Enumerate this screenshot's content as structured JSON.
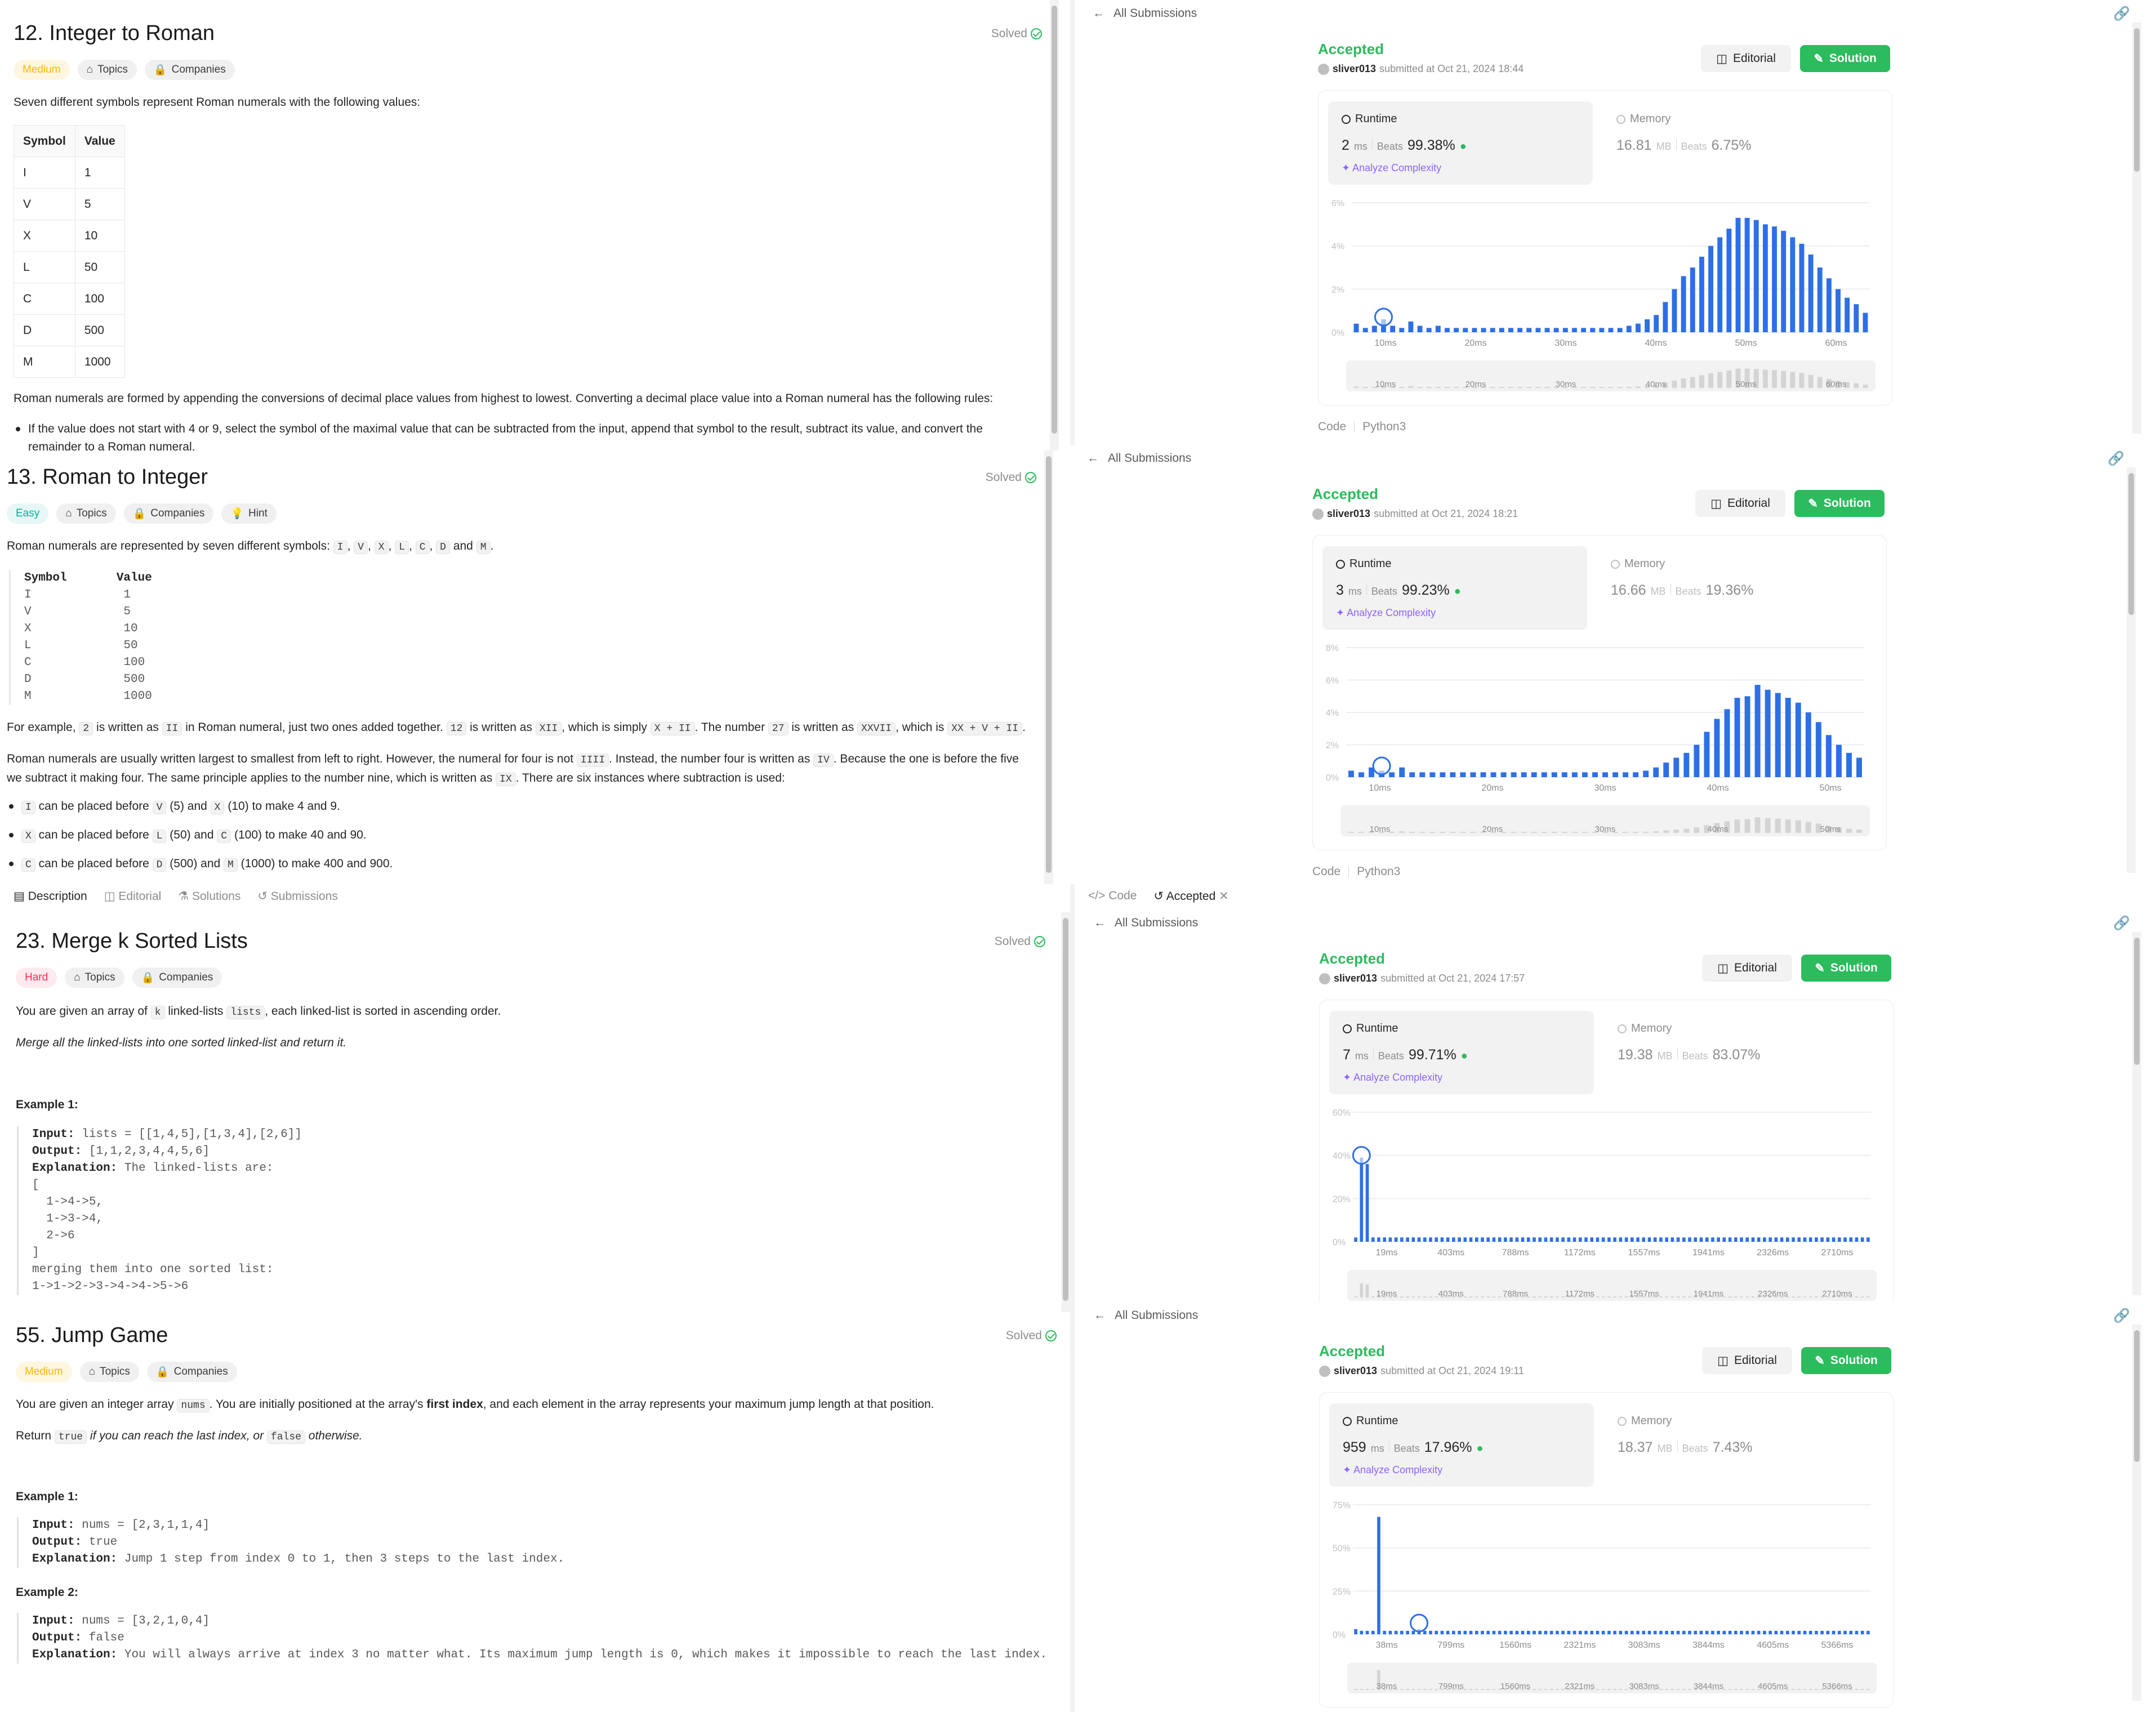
{
  "p12": {
    "title": "12. Integer to Roman",
    "solved": "Solved",
    "difficulty": "Medium",
    "topics": "Topics",
    "companies": "Companies",
    "intro": "Seven different symbols represent Roman numerals with the following values:",
    "table_headers": [
      "Symbol",
      "Value"
    ],
    "table_rows": [
      [
        "I",
        "1"
      ],
      [
        "V",
        "5"
      ],
      [
        "X",
        "10"
      ],
      [
        "L",
        "50"
      ],
      [
        "C",
        "100"
      ],
      [
        "D",
        "500"
      ],
      [
        "M",
        "1000"
      ]
    ],
    "para": "Roman numerals are formed by appending the conversions of decimal place values from highest to lowest. Converting a decimal place value into a Roman numeral has the following rules:",
    "bullet": "If the value does not start with 4 or 9, select the symbol of the maximal value that can be subtracted from the input, append that symbol to the result, subtract its value, and convert the",
    "bullet_cut": "remainder to a Roman numeral."
  },
  "p13": {
    "title": "13. Roman to Integer",
    "solved": "Solved",
    "difficulty": "Easy",
    "topics": "Topics",
    "companies": "Companies",
    "hint": "Hint",
    "intro_a": "Roman numerals are represented by seven different symbols: ",
    "intro_syms": [
      "I",
      "V",
      "X",
      "L",
      "C",
      "D",
      "M"
    ],
    "intro_and": " and ",
    "pre_header": "Symbol       Value",
    "pre_rows": [
      "I             1",
      "V             5",
      "X             10",
      "L             50",
      "C             100",
      "D             500",
      "M             1000"
    ],
    "ex_1": "For example, ",
    "ex_2": "2",
    "ex_3": " is written as ",
    "ex_4": "II",
    "ex_5": " in Roman numeral, just two ones added together. ",
    "ex_6": "12",
    "ex_7": " is written as ",
    "ex_8": "XII",
    "ex_9": ", which is simply ",
    "ex_10": "X + II",
    "ex_11": ". The number ",
    "ex_12": "27",
    "ex_13": " is written as ",
    "ex_14": "XXVII",
    "ex_15": ", which is ",
    "ex_16": "XX + V + II",
    "ex_17": ".",
    "usual_1": "Roman numerals are usually written largest to smallest from left to right. However, the numeral for four is not ",
    "usual_2": "IIII",
    "usual_3": ". Instead, the number four is written as ",
    "usual_4": "IV",
    "usual_5": ". Because the one is before the five we subtract it making four. The same principle applies to the number nine, which is written as ",
    "usual_6": "IX",
    "usual_7": ". There are six instances where subtraction is used:",
    "b1": [
      " can be placed before ",
      " (5) and ",
      " (10) to make 4 and 9."
    ],
    "b1c": [
      "I",
      "V",
      "X"
    ],
    "b2": [
      " can be placed before ",
      " (50) and ",
      " (100) to make 40 and 90."
    ],
    "b2c": [
      "X",
      "L",
      "C"
    ],
    "b3": [
      " can be placed before ",
      " (500) and ",
      " (1000) to make 400 and 900."
    ],
    "b3c": [
      "C",
      "D",
      "M"
    ]
  },
  "tabs_left": [
    "Description",
    "Editorial",
    "Solutions",
    "Submissions"
  ],
  "tabs_right": [
    "Code",
    "Accepted"
  ],
  "p23": {
    "title": "23. Merge k Sorted Lists",
    "solved": "Solved",
    "difficulty": "Hard",
    "topics": "Topics",
    "companies": "Companies",
    "l1a": "You are given an array of ",
    "l1b": "k",
    "l1c": " linked-lists ",
    "l1d": "lists",
    "l1e": ", each linked-list is sorted in ascending order.",
    "l2": "Merge all the linked-lists into one sorted linked-list and return it.",
    "ex1": "Example 1:",
    "in_lbl": "Input:",
    "in_val": " lists = [[1,4,5],[1,3,4],[2,6]]",
    "out_lbl": "Output:",
    "out_val": " [1,1,2,3,4,4,5,6]",
    "exp_lbl": "Explanation:",
    "exp_val": " The linked-lists are:",
    "rest": [
      "[",
      "  1->4->5,",
      "  1->3->4,",
      "  2->6",
      "]",
      "merging them into one sorted list:",
      "1->1->2->3->4->4->5->6"
    ]
  },
  "p55": {
    "title": "55. Jump Game",
    "solved": "Solved",
    "difficulty": "Medium",
    "topics": "Topics",
    "companies": "Companies",
    "l1a": "You are given an integer array ",
    "l1b": "nums",
    "l1c": ". You are initially positioned at the array's ",
    "l1d": "first index",
    "l1e": ", and each element in the array represents your maximum jump length at that position.",
    "l2a": "Return ",
    "l2b": "true",
    "l2c": " if you can reach the last index, or ",
    "l2d": "false",
    "l2e": " otherwise.",
    "ex1": "Example 1:",
    "ex1_in": " nums = [2,3,1,1,4]",
    "ex1_out": " true",
    "ex1_exp": " Jump 1 step from index 0 to 1, then 3 steps to the last index.",
    "ex2": "Example 2:",
    "ex2_in": " nums = [3,2,1,0,4]",
    "ex2_out": " false",
    "ex2_exp": " You will always arrive at index 3 no matter what. Its maximum jump length is 0, which makes it impossible to reach the last index.",
    "in_lbl": "Input:",
    "out_lbl": "Output:",
    "exp_lbl": "Explanation:"
  },
  "submissions": [
    {
      "all": "All Submissions",
      "status": "Accepted",
      "user": "sliver013",
      "submitted": "submitted at Oct 21, 2024 18:44",
      "editorial": "Editorial",
      "solution": "Solution",
      "runtime_label": "Runtime",
      "runtime": "2",
      "runtime_unit": "ms",
      "beats_label": "Beats",
      "runtime_beats": "99.38%",
      "analyze": "Analyze Complexity",
      "memory_label": "Memory",
      "memory": "16.81",
      "memory_unit": "MB",
      "memory_beats": "6.75%",
      "code_label": "Code",
      "lang": "Python3"
    },
    {
      "all": "All Submissions",
      "status": "Accepted",
      "user": "sliver013",
      "submitted": "submitted at Oct 21, 2024 18:21",
      "editorial": "Editorial",
      "solution": "Solution",
      "runtime_label": "Runtime",
      "runtime": "3",
      "runtime_unit": "ms",
      "beats_label": "Beats",
      "runtime_beats": "99.23%",
      "analyze": "Analyze Complexity",
      "memory_label": "Memory",
      "memory": "16.66",
      "memory_unit": "MB",
      "memory_beats": "19.36%",
      "code_label": "Code",
      "lang": "Python3"
    },
    {
      "all": "All Submissions",
      "status": "Accepted",
      "user": "sliver013",
      "submitted": "submitted at Oct 21, 2024 17:57",
      "editorial": "Editorial",
      "solution": "Solution",
      "runtime_label": "Runtime",
      "runtime": "7",
      "runtime_unit": "ms",
      "beats_label": "Beats",
      "runtime_beats": "99.71%",
      "analyze": "Analyze Complexity",
      "memory_label": "Memory",
      "memory": "19.38",
      "memory_unit": "MB",
      "memory_beats": "83.07%"
    },
    {
      "all": "All Submissions",
      "status": "Accepted",
      "user": "sliver013",
      "submitted": "submitted at Oct 21, 2024 19:11",
      "editorial": "Editorial",
      "solution": "Solution",
      "runtime_label": "Runtime",
      "runtime": "959",
      "runtime_unit": "ms",
      "beats_label": "Beats",
      "runtime_beats": "17.96%",
      "analyze": "Analyze Complexity",
      "memory_label": "Memory",
      "memory": "18.37",
      "memory_unit": "MB",
      "memory_beats": "7.43%"
    }
  ],
  "colors": {
    "accent_green": "#2cbb5d",
    "bar_blue": "#2d6fe6",
    "medium": "#ffb800",
    "easy": "#00af9b",
    "hard": "#ff2d55"
  },
  "chart_data": [
    {
      "type": "bar",
      "title": "",
      "ylabels": [
        "6%",
        "4%",
        "2%",
        "0%"
      ],
      "ylim": [
        0,
        6
      ],
      "xlabels": [
        "10ms",
        "20ms",
        "30ms",
        "40ms",
        "50ms",
        "60ms"
      ],
      "x": [
        1,
        2,
        3,
        4,
        5,
        6,
        7,
        8,
        9,
        10,
        11,
        12,
        13,
        14,
        15,
        16,
        17,
        18,
        19,
        20,
        21,
        22,
        23,
        24,
        25,
        26,
        27,
        28,
        29,
        30,
        31,
        32,
        33,
        34,
        35,
        36,
        37,
        38,
        39,
        40,
        41,
        42,
        43,
        44,
        45,
        46,
        47,
        48,
        49,
        50,
        51,
        52,
        53,
        54,
        55,
        56,
        57,
        58,
        59,
        60,
        61
      ],
      "values": [
        0.4,
        0.2,
        0.3,
        0.6,
        0.3,
        0.2,
        0.5,
        0.3,
        0.2,
        0.3,
        0.2,
        0.2,
        0.2,
        0.2,
        0.2,
        0.2,
        0.2,
        0.2,
        0.2,
        0.2,
        0.2,
        0.2,
        0.2,
        0.2,
        0.2,
        0.2,
        0.2,
        0.2,
        0.2,
        0.2,
        0.3,
        0.4,
        0.6,
        0.8,
        1.4,
        2.0,
        2.6,
        3.0,
        3.5,
        4.0,
        4.4,
        4.8,
        5.3,
        5.3,
        5.2,
        5.0,
        4.9,
        4.7,
        4.4,
        4.1,
        3.6,
        3.0,
        2.5,
        2.0,
        1.6,
        1.3,
        0.9
      ],
      "highlight_x": 3
    },
    {
      "type": "bar",
      "title": "",
      "ylabels": [
        "8%",
        "6%",
        "4%",
        "2%",
        "0%"
      ],
      "ylim": [
        0,
        8
      ],
      "xlabels": [
        "10ms",
        "20ms",
        "30ms",
        "40ms",
        "50ms"
      ],
      "values": [
        0.4,
        0.3,
        0.6,
        0.4,
        0.3,
        0.6,
        0.3,
        0.3,
        0.3,
        0.3,
        0.3,
        0.3,
        0.3,
        0.3,
        0.3,
        0.3,
        0.3,
        0.3,
        0.3,
        0.3,
        0.3,
        0.3,
        0.3,
        0.3,
        0.3,
        0.3,
        0.3,
        0.3,
        0.3,
        0.4,
        0.6,
        0.9,
        1.2,
        1.5,
        2.0,
        2.8,
        3.6,
        4.2,
        4.9,
        5.0,
        5.7,
        5.4,
        5.2,
        4.9,
        4.6,
        4.0,
        3.4,
        2.6,
        2.0,
        1.5,
        1.2
      ],
      "highlight_x": 3
    },
    {
      "type": "bar",
      "title": "",
      "ylabels": [
        "60%",
        "40%",
        "20%",
        "0%"
      ],
      "ylim": [
        0,
        60
      ],
      "xlabels": [
        "19ms",
        "403ms",
        "788ms",
        "1172ms",
        "1557ms",
        "1941ms",
        "2326ms",
        "2710ms"
      ],
      "values": [
        2,
        39,
        36,
        2,
        2,
        2,
        2,
        2,
        2,
        2,
        2,
        2,
        2,
        2,
        2,
        2,
        2,
        2,
        2,
        2,
        2,
        2,
        2,
        2,
        2,
        2,
        2,
        2,
        2,
        2,
        2,
        2,
        2,
        2,
        2,
        2,
        2,
        2,
        2,
        2,
        2,
        2,
        2,
        2,
        2,
        2,
        2,
        2,
        2,
        2,
        2,
        2,
        2,
        2,
        2,
        2,
        2,
        2,
        2,
        2,
        2,
        2,
        2,
        2,
        2,
        2,
        2,
        2,
        2,
        2,
        2,
        2,
        2,
        2,
        2,
        2,
        2,
        2,
        2,
        2,
        2,
        2,
        2,
        2,
        2,
        2,
        2,
        2,
        2,
        2
      ],
      "highlight_x": 1
    },
    {
      "type": "bar",
      "title": "",
      "ylabels": [
        "75%",
        "50%",
        "25%",
        "0%"
      ],
      "ylim": [
        0,
        75
      ],
      "xlabels": [
        "38ms",
        "799ms",
        "1560ms",
        "2321ms",
        "3083ms",
        "3844ms",
        "4605ms",
        "5366ms"
      ],
      "values": [
        3,
        2,
        2,
        2,
        68,
        2,
        2,
        2,
        2,
        2,
        2,
        3,
        2,
        2,
        2,
        2,
        2,
        2,
        2,
        2,
        2,
        2,
        2,
        2,
        2,
        2,
        2,
        2,
        2,
        2,
        2,
        2,
        2,
        2,
        2,
        2,
        2,
        2,
        2,
        2,
        2,
        2,
        2,
        2,
        2,
        2,
        2,
        2,
        2,
        2,
        2,
        2,
        2,
        2,
        2,
        2,
        2,
        2,
        2,
        2,
        2,
        2,
        2,
        2,
        2,
        2,
        2,
        2,
        2,
        2,
        2,
        2,
        2,
        2,
        2,
        2,
        2,
        2,
        2,
        2,
        2,
        2,
        2,
        2,
        2,
        2,
        2,
        2,
        2,
        2
      ],
      "highlight_x": 11
    }
  ]
}
